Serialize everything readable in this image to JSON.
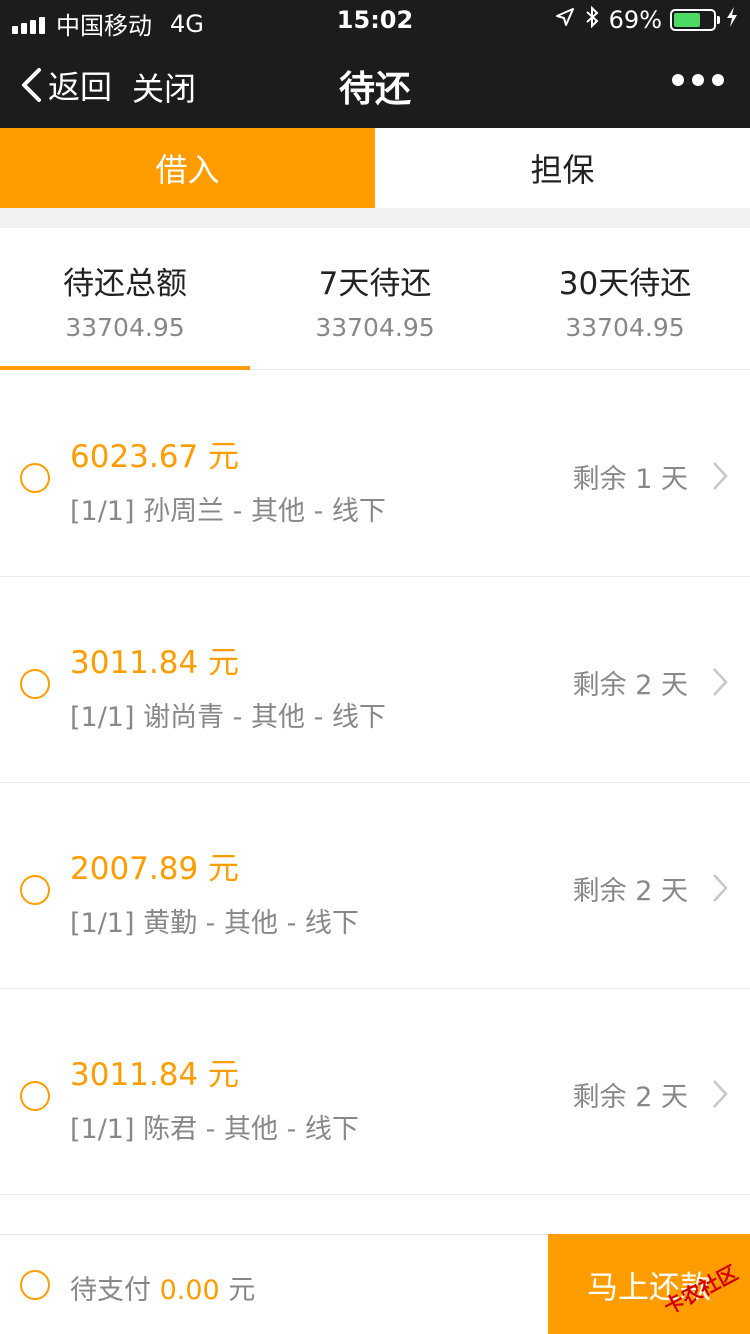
{
  "status_bar": {
    "carrier": "中国移动",
    "network": "4G",
    "time": "15:02",
    "battery": "69%",
    "battery_level": 0.69
  },
  "nav": {
    "back_label": "返回",
    "close_label": "关闭",
    "title": "待还"
  },
  "segment_tabs": [
    {
      "label": "借入",
      "active": true
    },
    {
      "label": "担保",
      "active": false
    }
  ],
  "summary_tabs": [
    {
      "label": "待还总额",
      "value": "33704.95"
    },
    {
      "label": "7天待还",
      "value": "33704.95"
    },
    {
      "label": "30天待还",
      "value": "33704.95"
    }
  ],
  "items": [
    {
      "amount": "6023.67 元",
      "desc": "[1/1] 孙周兰 - 其他 - 线下",
      "remain": "剩余 1 天"
    },
    {
      "amount": "3011.84 元",
      "desc": "[1/1] 谢尚青 - 其他 - 线下",
      "remain": "剩余 2 天"
    },
    {
      "amount": "2007.89 元",
      "desc": "[1/1] 黄勤 - 其他 - 线下",
      "remain": "剩余 2 天"
    },
    {
      "amount": "3011.84 元",
      "desc": "[1/1] 陈君 - 其他 - 线下",
      "remain": "剩余 2 天"
    }
  ],
  "footer": {
    "pending_label": "待支付",
    "pending_amount": "0.00",
    "pending_unit": "元",
    "pay_label": "马上还款",
    "watermark": "卡农社区"
  },
  "colors": {
    "accent": "#ff9d00",
    "bar": "#1c1c1e",
    "muted": "#888888"
  }
}
